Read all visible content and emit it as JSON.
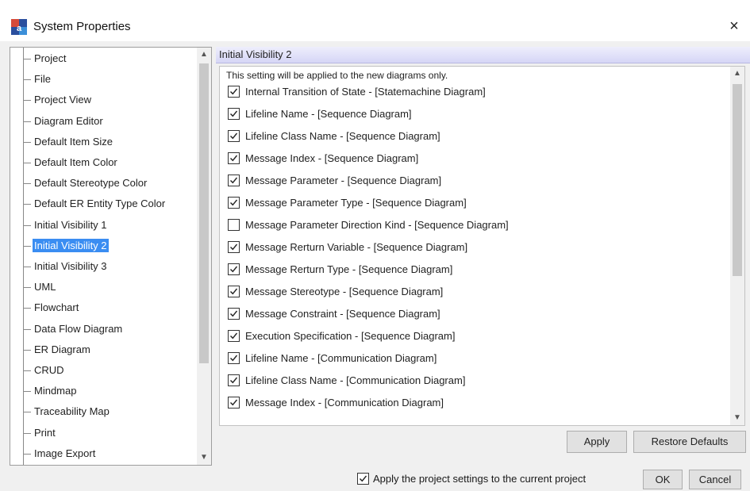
{
  "window": {
    "title": "System Properties",
    "close_label": "×"
  },
  "tree": {
    "selected_index": 9,
    "items": [
      "Project",
      "File",
      "Project View",
      "Diagram Editor",
      "Default Item Size",
      "Default Item Color",
      "Default Stereotype Color",
      "Default ER Entity Type Color",
      "Initial Visibility 1",
      "Initial Visibility 2",
      "Initial Visibility 3",
      "UML",
      "Flowchart",
      "Data Flow Diagram",
      "ER Diagram",
      "CRUD",
      "Mindmap",
      "Traceability Map",
      "Print",
      "Image Export"
    ]
  },
  "panel": {
    "header": "Initial Visibility 2",
    "note": "This setting will be applied to the new diagrams only.",
    "options": [
      {
        "label": "Internal Transition of State - [Statemachine Diagram]",
        "checked": true
      },
      {
        "label": "Lifeline Name - [Sequence Diagram]",
        "checked": true
      },
      {
        "label": "Lifeline Class Name - [Sequence Diagram]",
        "checked": true
      },
      {
        "label": "Message Index - [Sequence Diagram]",
        "checked": true
      },
      {
        "label": "Message Parameter - [Sequence Diagram]",
        "checked": true
      },
      {
        "label": "Message Parameter Type - [Sequence Diagram]",
        "checked": true
      },
      {
        "label": "Message Parameter Direction Kind - [Sequence Diagram]",
        "checked": false
      },
      {
        "label": "Message Rerturn Variable - [Sequence Diagram]",
        "checked": true
      },
      {
        "label": "Message Rerturn Type - [Sequence Diagram]",
        "checked": true
      },
      {
        "label": "Message Stereotype - [Sequence Diagram]",
        "checked": true
      },
      {
        "label": "Message Constraint - [Sequence Diagram]",
        "checked": true
      },
      {
        "label": "Execution Specification - [Sequence Diagram]",
        "checked": true
      },
      {
        "label": "Lifeline Name - [Communication Diagram]",
        "checked": true
      },
      {
        "label": "Lifeline Class Name - [Communication Diagram]",
        "checked": true
      },
      {
        "label": "Message Index - [Communication Diagram]",
        "checked": true
      }
    ],
    "apply_label": "Apply",
    "restore_label": "Restore Defaults"
  },
  "footer": {
    "apply_project_label": "Apply the project settings to the current project",
    "apply_project_checked": true,
    "ok_label": "OK",
    "cancel_label": "Cancel"
  },
  "colors": {
    "selection": "#3a8df2",
    "header_band": "#d6d6f6"
  }
}
